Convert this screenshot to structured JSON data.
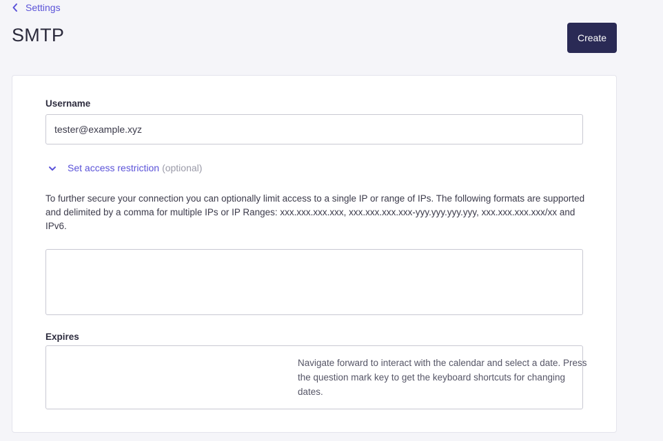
{
  "breadcrumb": {
    "back_label": "Settings",
    "icon": "chevron-left-icon"
  },
  "page": {
    "title": "SMTP"
  },
  "actions": {
    "create_label": "Create"
  },
  "form": {
    "username": {
      "label": "Username",
      "value": "tester@example.xyz"
    },
    "access_restriction": {
      "toggle_label": "Set access restriction",
      "optional_label": "(optional)",
      "icon": "chevron-down-icon",
      "help_text": "To further secure your connection you can optionally limit access to a single IP or range of IPs. The following formats are supported and delimited by a comma for multiple IPs or IP Ranges: xxx.xxx.xxx.xxx, xxx.xxx.xxx.xxx-yyy.yyy.yyy.yyy, xxx.xxx.xxx.xxx/xx and IPv6.",
      "value": ""
    },
    "expires": {
      "label": "Expires",
      "calendar_hint": "Navigate forward to interact with the calendar and select a date. Press the question mark key to get the keyboard shortcuts for changing dates."
    }
  },
  "colors": {
    "accent": "#5a52d8",
    "primary_button": "#2a2a55",
    "background": "#f5f5f9",
    "muted": "#9a9aa8"
  }
}
